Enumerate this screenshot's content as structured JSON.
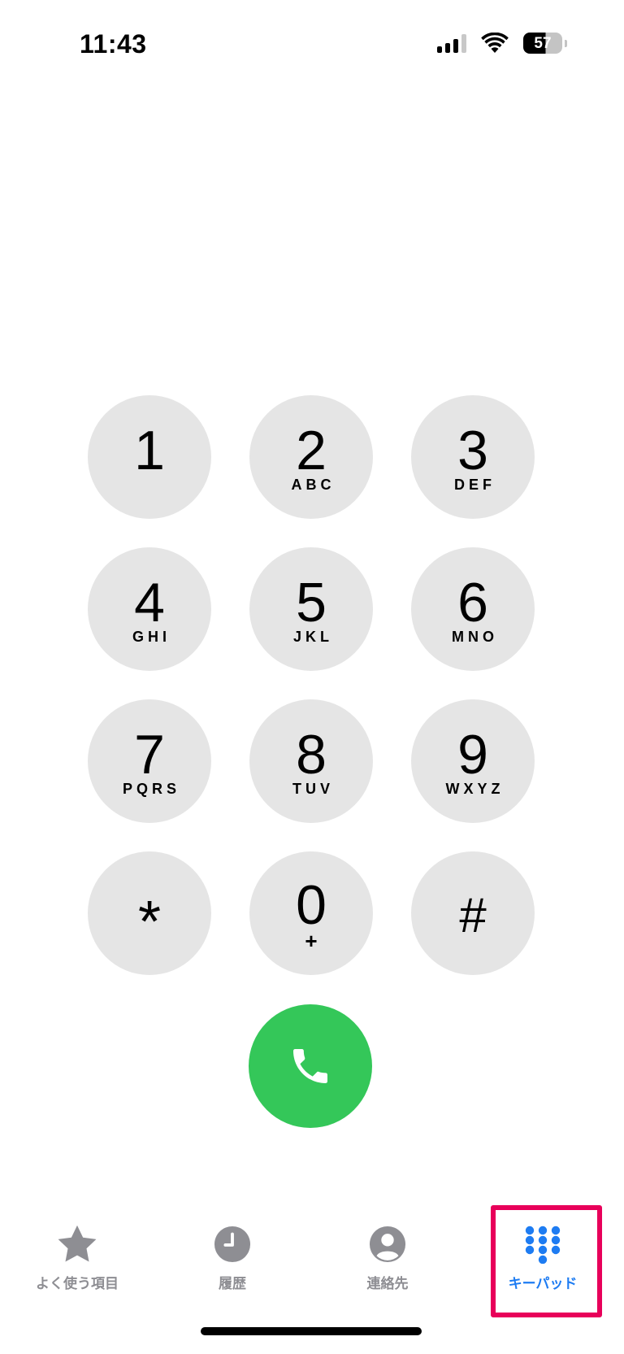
{
  "status_bar": {
    "time": "11:43",
    "battery_level": "57",
    "icons": [
      "cellular-signal-icon",
      "wifi-icon",
      "battery-icon"
    ]
  },
  "keypad": {
    "keys": [
      {
        "digit": "1",
        "letters": ""
      },
      {
        "digit": "2",
        "letters": "ABC"
      },
      {
        "digit": "3",
        "letters": "DEF"
      },
      {
        "digit": "4",
        "letters": "GHI"
      },
      {
        "digit": "5",
        "letters": "JKL"
      },
      {
        "digit": "6",
        "letters": "MNO"
      },
      {
        "digit": "7",
        "letters": "PQRS"
      },
      {
        "digit": "8",
        "letters": "TUV"
      },
      {
        "digit": "9",
        "letters": "WXYZ"
      },
      {
        "digit": "*",
        "letters": ""
      },
      {
        "digit": "0",
        "letters": "+"
      },
      {
        "digit": "#",
        "letters": ""
      }
    ]
  },
  "call_button": {
    "icon": "phone-icon",
    "color": "#34c759"
  },
  "tab_bar": {
    "active_color": "#1e7cf2",
    "inactive_color": "#8e8e93",
    "tabs": [
      {
        "label": "よく使う項目",
        "icon": "star-icon"
      },
      {
        "label": "履歴",
        "icon": "clock-icon"
      },
      {
        "label": "連絡先",
        "icon": "person-icon"
      },
      {
        "label": "キーパッド",
        "icon": "keypad-icon",
        "active": true
      }
    ]
  },
  "annotation": {
    "highlight_color": "#e8005a"
  }
}
